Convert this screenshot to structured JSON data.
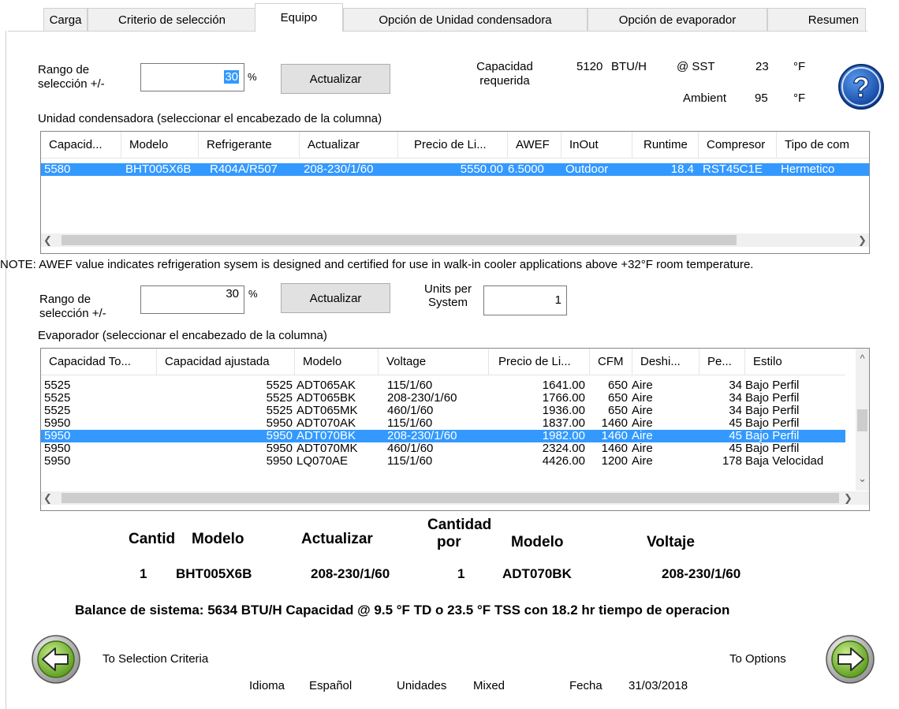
{
  "tabs": [
    "Carga",
    "Criterio de selección",
    "Equipo",
    "Opción de Unidad condensadora",
    "Opción de evaporador",
    "Resumen"
  ],
  "condensing": {
    "range_label_1": "Rango de",
    "range_label_2": "selección +/-",
    "range_value": "30",
    "percent": "%",
    "update_button": "Actualizar",
    "capacity_label_1": "Capacidad",
    "capacity_label_2": "requerida",
    "capacity_value": "5120",
    "capacity_unit": "BTU/H",
    "sst_label": "@ SST",
    "sst_value": "23",
    "sst_unit": "°F",
    "ambient_label": "Ambient",
    "ambient_value": "95",
    "ambient_unit": "°F",
    "grid_caption": "Unidad condensadora (seleccionar el encabezado de la columna)",
    "columns": [
      "Capacid...",
      "Modelo",
      "Refrigerante",
      "Actualizar",
      "Precio de Li...",
      "AWEF",
      "InOut",
      "Runtime",
      "Compresor",
      "Tipo de com"
    ],
    "rows": [
      [
        "5580",
        "BHT005X6B",
        "R404A/R507",
        "208-230/1/60",
        "5550.00",
        "6.5000",
        "Outdoor",
        "18.4",
        "RST45C1E",
        "Hermetico"
      ]
    ]
  },
  "note": "NOTE: AWEF value indicates refrigeration sysem is designed and certified for use in walk-in cooler applications above +32°F room temperature.",
  "evaporator": {
    "range_label_1": "Rango de",
    "range_label_2": "selección +/-",
    "range_value": "30",
    "percent": "%",
    "update_button": "Actualizar",
    "units_label_1": "Units per",
    "units_label_2": "System",
    "units_value": "1",
    "grid_caption": "Evaporador (seleccionar el encabezado de la columna)",
    "columns": [
      "Capacidad To...",
      "Capacidad ajustada",
      "Modelo",
      "Voltage",
      "Precio de Li...",
      "CFM",
      "Deshi...",
      "Pe...",
      "Estilo"
    ],
    "rows": [
      [
        "5525",
        "5525",
        "ADT065AK",
        "115/1/60",
        "1641.00",
        "650",
        "Aire",
        "34",
        "Bajo Perfil"
      ],
      [
        "5525",
        "5525",
        "ADT065BK",
        "208-230/1/60",
        "1766.00",
        "650",
        "Aire",
        "34",
        "Bajo Perfil"
      ],
      [
        "5525",
        "5525",
        "ADT065MK",
        "460/1/60",
        "1936.00",
        "650",
        "Aire",
        "34",
        "Bajo Perfil"
      ],
      [
        "5950",
        "5950",
        "ADT070AK",
        "115/1/60",
        "1837.00",
        "1460",
        "Aire",
        "45",
        "Bajo Perfil"
      ],
      [
        "5950",
        "5950",
        "ADT070BK",
        "208-230/1/60",
        "1982.00",
        "1460",
        "Aire",
        "45",
        "Bajo Perfil"
      ],
      [
        "5950",
        "5950",
        "ADT070MK",
        "460/1/60",
        "2324.00",
        "1460",
        "Aire",
        "45",
        "Bajo Perfil"
      ],
      [
        "5950",
        "5950",
        "LQ070AE",
        "115/1/60",
        "4426.00",
        "1200",
        "Aire",
        "178",
        "Baja Velocidad"
      ]
    ],
    "selected_row": 4
  },
  "summary": {
    "h_cantidad": "Cantid",
    "h_modelo1": "Modelo",
    "h_actualizar": "Actualizar",
    "h_cantidad2_1": "Cantidad",
    "h_cantidad2_2": "por",
    "h_modelo2": "Modelo",
    "h_voltaje": "Voltaje",
    "v_cantidad": "1",
    "v_modelo1": "BHT005X6B",
    "v_actualizar": "208-230/1/60",
    "v_cantidad2": "1",
    "v_modelo2": "ADT070BK",
    "v_voltaje": "208-230/1/60",
    "balance": "Balance de sistema: 5634 BTU/H Capacidad @ 9.5 °F TD o 23.5 °F TSS con 18.2 hr tiempo de operacion"
  },
  "nav": {
    "back_label": "To Selection Criteria",
    "next_label": "To Options"
  },
  "footer": {
    "idioma_label": "Idioma",
    "idioma_value": "Español",
    "unidades_label": "Unidades",
    "unidades_value": "Mixed",
    "fecha_label": "Fecha",
    "fecha_value": "31/03/2018"
  },
  "colors": {
    "selection": "#3399ff",
    "help_button": "#1f5fbf",
    "nav_green": "#7fbf3a"
  },
  "icons": [
    "help-icon",
    "back-arrow-icon",
    "next-arrow-icon",
    "scroll-left-icon",
    "scroll-right-icon",
    "scroll-up-icon",
    "scroll-down-icon"
  ]
}
